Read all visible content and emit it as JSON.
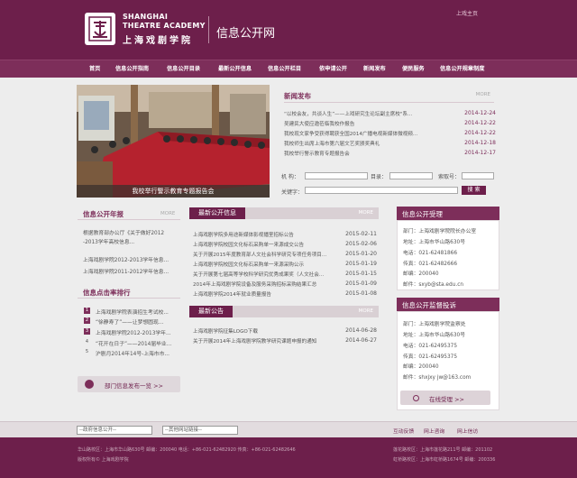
{
  "header": {
    "logo_en_line1": "SHANGHAI",
    "logo_en_line2": "THEATRE ACADEMY",
    "logo_cn": "上海戏剧学院",
    "site_title": "信息公开网",
    "home_link": "上戏主页"
  },
  "nav": {
    "items": [
      "首页",
      "信息公开指南",
      "信息公开目录",
      "最新公开信息",
      "信息公开栏目",
      "依申请公开",
      "新闻发布",
      "便民服务",
      "信息公开规章制度"
    ]
  },
  "slider": {
    "caption": "我校举行警示教育专题报告会"
  },
  "news": {
    "title": "新闻发布",
    "more": "MORE",
    "items": [
      {
        "title": "“以校会友，共谈人生”——上戏研究生论坛副主席校\"系...",
        "date": "2014-12-24"
      },
      {
        "title": "吴建民大使应邀莅临我校作报告",
        "date": "2014-12-22"
      },
      {
        "title": "我校现文家争受获得聘获全国2014广播电视新媒体微视频...",
        "date": "2014-12-22"
      },
      {
        "title": "我校师生出席上海市第六届文艺奖颁奖典礼",
        "date": "2014-12-18"
      },
      {
        "title": "我校举行警示教育专题报告会",
        "date": "2014-12-17"
      }
    ]
  },
  "search": {
    "org_label": "机 构：",
    "catalog_label": "目录：",
    "index_label": "索取号：",
    "keyword_label": "关键字：",
    "button": "搜 索"
  },
  "annual_report": {
    "title": "信息公开年报",
    "more": "MORE",
    "items": [
      "根据教育部办公厅《关于做好2012",
      "-2013学年高校信息...",
      "上海戏剧学院2012-2013学年信息...",
      "上海戏剧学院2011-2012学年信息..."
    ]
  },
  "ranking": {
    "title": "信息点击率排行",
    "items": [
      {
        "num": "1",
        "text": "上海戏剧学院表演招生考试校..."
      },
      {
        "num": "2",
        "text": "“徐静寿了”——让梦想圆现..."
      },
      {
        "num": "3",
        "text": "上海戏剧学院2012-2013学年..."
      },
      {
        "num": "4",
        "text": "“花开在日子”——2014届毕业..."
      },
      {
        "num": "5",
        "text": "沪剧月2014年14号-上海市市..."
      }
    ]
  },
  "dept_button": {
    "label": "部门信息发布一览 >>"
  },
  "latest_info": {
    "title": "最新公开信息",
    "more": "MORE",
    "items": [
      {
        "title": "上海戏剧学院多用途新媒体影视播室招标公告",
        "date": "2015-02-11"
      },
      {
        "title": "上海戏剧学院校园文化标石采购单一来源成交公告",
        "date": "2015-02-06"
      },
      {
        "title": "关于开展2015年度教育部人文社会科学研究专项任务项目...",
        "date": "2015-01-20"
      },
      {
        "title": "上海戏剧学院校园文化标石采购单一来源采购公示",
        "date": "2015-01-19"
      },
      {
        "title": "关于开展第七届高等学校科学研究优秀成果奖（人文社会...",
        "date": "2015-01-15"
      },
      {
        "title": "2014年上海戏剧学院设备及服务采购招标采购结果汇总",
        "date": "2015-01-09"
      },
      {
        "title": "上海戏剧学院2014年就业质量报告",
        "date": "2015-01-08"
      }
    ]
  },
  "latest_notice": {
    "title": "最新公告",
    "more": "MORE",
    "items": [
      {
        "title": "上海戏剧学院征集LOGO下载",
        "date": "2014-06-28"
      },
      {
        "title": "关于开展2014年上海戏剧学院教学研究课题申报的通知",
        "date": "2014-06-27"
      }
    ]
  },
  "acceptance": {
    "title": "信息公开受理",
    "lines": [
      "部门：上海戏剧学院院长办公室",
      "地址：上海市华山路630号",
      "电话：021-62481866",
      "传真：021-62482666",
      "邮编：200040",
      "邮件：sxyb@sta.edu.cn"
    ]
  },
  "supervision": {
    "title": "信息公开监督投诉",
    "lines": [
      "部门：上海戏剧学院监察处",
      "地址：上海市华山路630号",
      "电话：021-62495375",
      "传真：021-62495375",
      "邮编：200040",
      "邮件：shxjxy jw@163.com"
    ],
    "button": "在线受理 >>"
  },
  "footer_bar": {
    "select1": "--政府信息公开--",
    "select2": "--其他网站链接--",
    "links": [
      "互动反馈",
      "网上咨询",
      "网上信访"
    ]
  },
  "footer": {
    "line1_left": "华山路校区：上海市华山路630号  邮编：200040  电话：+86-021-62482920  传真：+86-021-62482646",
    "line2_left": "版权所有© 上海戏剧学院",
    "line1_right": "莲花路校区：上海市莲花路211号  邮编：201102",
    "line2_right": "虹桥路校区：上海市虹桥路1674号  邮编：200336"
  }
}
